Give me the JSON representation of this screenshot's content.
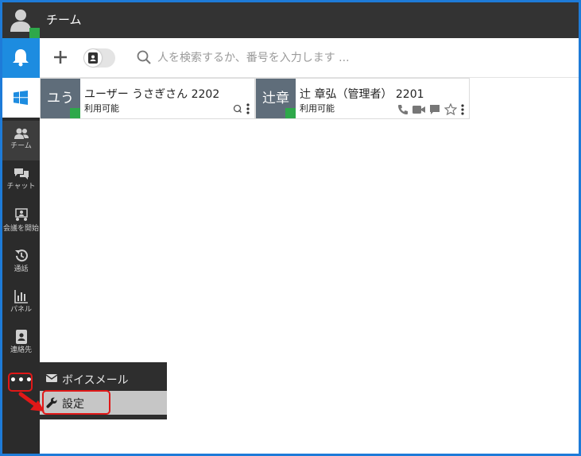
{
  "header": {
    "title": "チーム"
  },
  "sidebar": {
    "items": [
      {
        "label": "チーム",
        "icon": "team-icon"
      },
      {
        "label": "チャット",
        "icon": "chat-icon"
      },
      {
        "label": "会議を開始",
        "icon": "meeting-icon"
      },
      {
        "label": "通話",
        "icon": "history-icon"
      },
      {
        "label": "パネル",
        "icon": "panel-icon"
      },
      {
        "label": "連絡先",
        "icon": "contacts-icon"
      }
    ],
    "more_label": "•••"
  },
  "toolbar": {
    "search_placeholder": "人を検索するか、番号を入力します ..."
  },
  "contacts": [
    {
      "initials": "ユう",
      "name": "ユーザー うさぎさん 2202",
      "status": "利用可能"
    },
    {
      "initials": "辻章",
      "name": "辻 章弘（管理者） 2201",
      "status": "利用可能"
    }
  ],
  "menu": {
    "items": [
      {
        "label": "ボイスメール"
      },
      {
        "label": "設定"
      }
    ]
  },
  "colors": {
    "accent": "#1d8ce0",
    "presence": "#2ea84a",
    "highlight": "#e01818",
    "frame": "#1e7bd8"
  }
}
